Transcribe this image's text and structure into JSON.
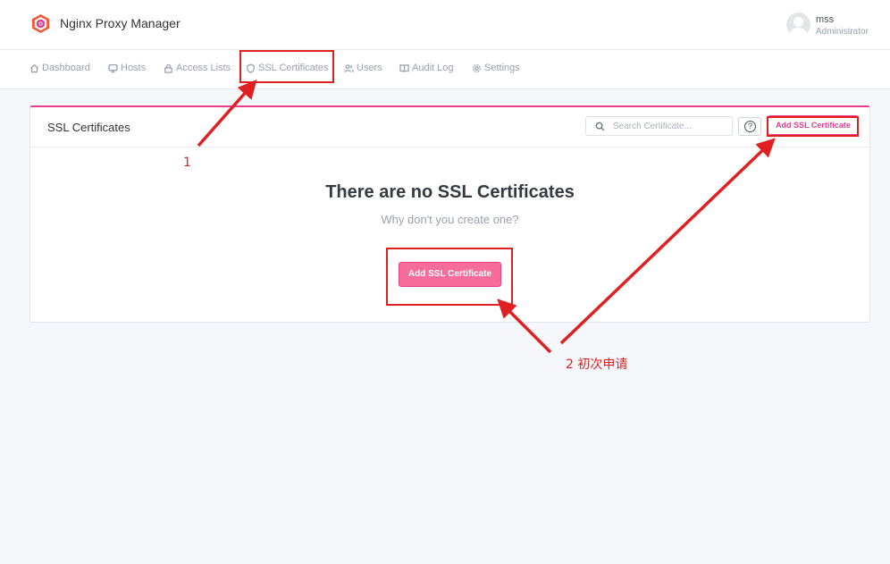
{
  "header": {
    "app_title": "Nginx Proxy Manager",
    "user_name": "mss",
    "user_role": "Administrator"
  },
  "nav": {
    "items": [
      {
        "label": "Dashboard",
        "icon": "home-icon"
      },
      {
        "label": "Hosts",
        "icon": "monitor-icon"
      },
      {
        "label": "Access Lists",
        "icon": "lock-icon"
      },
      {
        "label": "SSL Certificates",
        "icon": "shield-icon"
      },
      {
        "label": "Users",
        "icon": "users-icon"
      },
      {
        "label": "Audit Log",
        "icon": "book-icon"
      },
      {
        "label": "Settings",
        "icon": "gear-icon"
      }
    ]
  },
  "card": {
    "title": "SSL Certificates",
    "search_placeholder": "Search Certificate...",
    "help_label": "?",
    "add_button_label": "Add SSL Certificate",
    "empty_title": "There are no SSL Certificates",
    "empty_subtitle": "Why don't you create one?",
    "empty_button_label": "Add SSL Certificate"
  },
  "annotations": {
    "label_1": "1",
    "label_2": "2 初次申请"
  },
  "colors": {
    "accent": "#e83e8c",
    "annotation": "#e02020"
  }
}
